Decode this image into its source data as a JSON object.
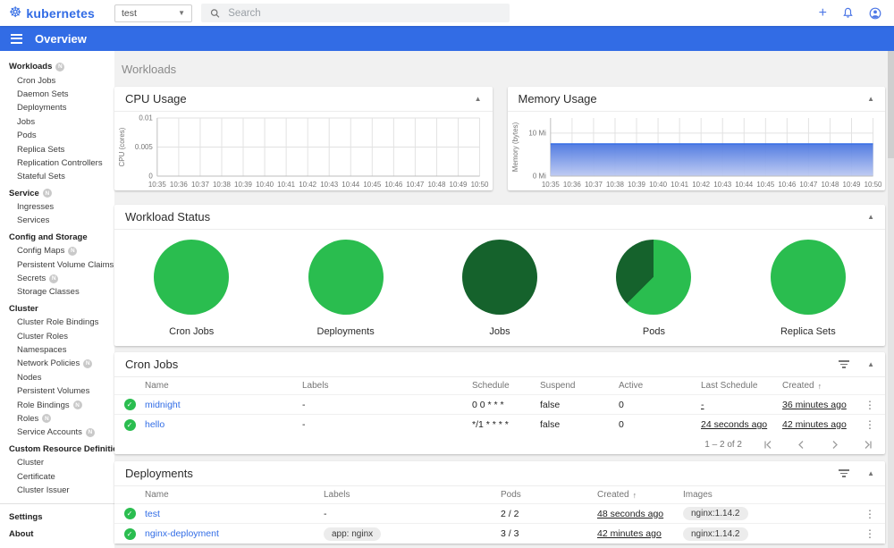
{
  "colors": {
    "primary": "#326ce5",
    "link": "#326de6",
    "green": "#2abd4f",
    "dark_green": "#15622c",
    "chart_grid": "#e2e2e2",
    "chart_axis": "#bdbdbd"
  },
  "topbar": {
    "logo": "kubernetes",
    "namespace": "test",
    "search_placeholder": "Search"
  },
  "appbar": {
    "title": "Overview"
  },
  "sidebar": {
    "badge_text": "N",
    "items": [
      {
        "label": "Workloads",
        "type": "header",
        "badge": true
      },
      {
        "label": "Cron Jobs",
        "type": "item",
        "badge": false
      },
      {
        "label": "Daemon Sets",
        "type": "item",
        "badge": false
      },
      {
        "label": "Deployments",
        "type": "item",
        "badge": false
      },
      {
        "label": "Jobs",
        "type": "item",
        "badge": false
      },
      {
        "label": "Pods",
        "type": "item",
        "badge": false
      },
      {
        "label": "Replica Sets",
        "type": "item",
        "badge": false
      },
      {
        "label": "Replication Controllers",
        "type": "item",
        "badge": false
      },
      {
        "label": "Stateful Sets",
        "type": "item",
        "badge": false
      },
      {
        "label": "Service",
        "type": "header",
        "badge": true
      },
      {
        "label": "Ingresses",
        "type": "item",
        "badge": false
      },
      {
        "label": "Services",
        "type": "item",
        "badge": false
      },
      {
        "label": "Config and Storage",
        "type": "header",
        "badge": false
      },
      {
        "label": "Config Maps",
        "type": "item",
        "badge": true
      },
      {
        "label": "Persistent Volume Claims",
        "type": "item",
        "badge": true
      },
      {
        "label": "Secrets",
        "type": "item",
        "badge": true
      },
      {
        "label": "Storage Classes",
        "type": "item",
        "badge": false
      },
      {
        "label": "Cluster",
        "type": "header",
        "badge": false
      },
      {
        "label": "Cluster Role Bindings",
        "type": "item",
        "badge": false
      },
      {
        "label": "Cluster Roles",
        "type": "item",
        "badge": false
      },
      {
        "label": "Namespaces",
        "type": "item",
        "badge": false
      },
      {
        "label": "Network Policies",
        "type": "item",
        "badge": true
      },
      {
        "label": "Nodes",
        "type": "item",
        "badge": false
      },
      {
        "label": "Persistent Volumes",
        "type": "item",
        "badge": false
      },
      {
        "label": "Role Bindings",
        "type": "item",
        "badge": true
      },
      {
        "label": "Roles",
        "type": "item",
        "badge": true
      },
      {
        "label": "Service Accounts",
        "type": "item",
        "badge": true
      },
      {
        "label": "Custom Resource Definitions",
        "type": "header",
        "badge": false
      },
      {
        "label": "Cluster",
        "type": "item",
        "badge": false
      },
      {
        "label": "Certificate",
        "type": "item",
        "badge": false
      },
      {
        "label": "Cluster Issuer",
        "type": "item",
        "badge": false
      },
      {
        "label": "",
        "type": "divider",
        "badge": false
      },
      {
        "label": "Settings",
        "type": "header",
        "badge": false
      },
      {
        "label": "About",
        "type": "header",
        "badge": false
      }
    ]
  },
  "page": {
    "title": "Workloads"
  },
  "chart_data": [
    {
      "type": "line",
      "title": "CPU Usage",
      "ylabel": "CPU (cores)",
      "x": [
        "10:35",
        "10:36",
        "10:37",
        "10:38",
        "10:39",
        "10:40",
        "10:41",
        "10:42",
        "10:43",
        "10:44",
        "10:45",
        "10:46",
        "10:47",
        "10:48",
        "10:49",
        "10:50"
      ],
      "y_ticks": [
        {
          "v": 0,
          "label": "0"
        },
        {
          "v": 0.005,
          "label": "0.005"
        },
        {
          "v": 0.01,
          "label": "0.01"
        }
      ],
      "ymax": 0.01,
      "area": null,
      "color": "#326ce5",
      "grid": true,
      "note": "no visible series data"
    },
    {
      "type": "area",
      "title": "Memory Usage",
      "ylabel": "Memory (bytes)",
      "x": [
        "10:35",
        "10:36",
        "10:37",
        "10:38",
        "10:39",
        "10:40",
        "10:41",
        "10:42",
        "10:43",
        "10:44",
        "10:45",
        "10:46",
        "10:47",
        "10:48",
        "10:49",
        "10:50"
      ],
      "y_ticks": [
        {
          "v": 0,
          "label": "0 Mi"
        },
        {
          "v": 10,
          "label": "10 Mi"
        }
      ],
      "ymax": 13.5,
      "area": 7.5,
      "color": "#326ce5",
      "grid": true,
      "note": "constant memory usage ~7.5 Mi across the whole window"
    },
    {
      "type": "pie",
      "title": "Workload Status",
      "pies": [
        {
          "label": "Cron Jobs",
          "slices": [
            {
              "value": 100,
              "color": "#2abd4f"
            }
          ]
        },
        {
          "label": "Deployments",
          "slices": [
            {
              "value": 100,
              "color": "#2abd4f"
            }
          ]
        },
        {
          "label": "Jobs",
          "slices": [
            {
              "value": 100,
              "color": "#15622c"
            }
          ]
        },
        {
          "label": "Pods",
          "slices": [
            {
              "value": 62.5,
              "color": "#2abd4f"
            },
            {
              "value": 37.5,
              "color": "#15622c"
            }
          ]
        },
        {
          "label": "Replica Sets",
          "slices": [
            {
              "value": 100,
              "color": "#2abd4f"
            }
          ]
        }
      ]
    }
  ],
  "tables": {
    "cron_jobs": {
      "title": "Cron Jobs",
      "columns": [
        "Name",
        "Labels",
        "Schedule",
        "Suspend",
        "Active",
        "Last Schedule",
        "Created"
      ],
      "sorted_column": "Created",
      "sort_arrow": "↑",
      "rows": [
        {
          "name": "midnight",
          "labels": "-",
          "schedule": "0 0 * * *",
          "suspend": "false",
          "active": "0",
          "last_schedule": "-",
          "created": "36 minutes ago"
        },
        {
          "name": "hello",
          "labels": "-",
          "schedule": "*/1 * * * *",
          "suspend": "false",
          "active": "0",
          "last_schedule": "24 seconds ago",
          "created": "42 minutes ago"
        }
      ],
      "pagination": "1 – 2 of 2"
    },
    "deployments": {
      "title": "Deployments",
      "columns": [
        "Name",
        "Labels",
        "Pods",
        "Created",
        "Images"
      ],
      "sorted_column": "Created",
      "sort_arrow": "↑",
      "rows": [
        {
          "name": "test",
          "labels": "-",
          "labels_is_chip": false,
          "pods": "2 / 2",
          "created": "48 seconds ago",
          "images": "nginx:1.14.2"
        },
        {
          "name": "nginx-deployment",
          "labels": "app: nginx",
          "labels_is_chip": true,
          "pods": "3 / 3",
          "created": "42 minutes ago",
          "images": "nginx:1.14.2"
        }
      ]
    }
  }
}
